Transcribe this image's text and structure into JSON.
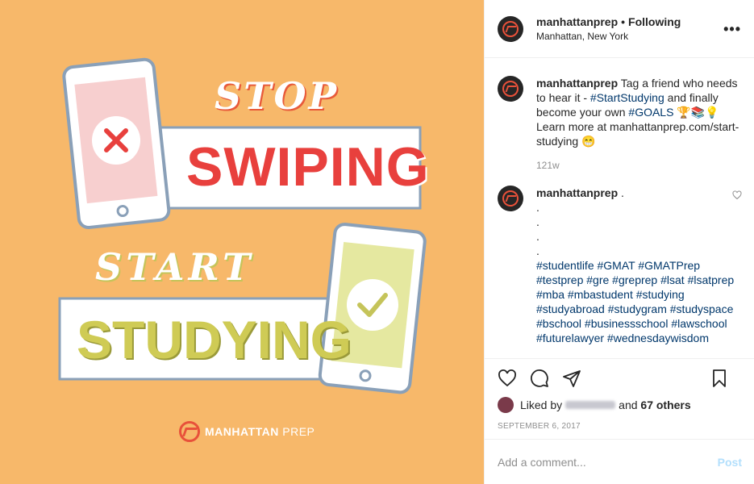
{
  "image": {
    "line1": "STOP",
    "line2": "SWIPING",
    "line3": "START",
    "line4": "STUDYING",
    "brand_bold": "MANHATTAN",
    "brand_light": "PREP",
    "colors": {
      "background": "#f7b86a",
      "red": "#e8403d",
      "green": "#cfcb55"
    }
  },
  "header": {
    "username": "manhattanprep",
    "separator": "•",
    "follow_status": "Following",
    "location": "Manhattan, New York",
    "more_icon": "more-horizontal-icon"
  },
  "caption": {
    "username": "manhattanprep",
    "text_1": "Tag a friend who needs to hear it - ",
    "hashtag_1": "#StartStudying",
    "text_2": " and finally become your own ",
    "hashtag_2": "#GOALS",
    "emojis": "🏆📚💡",
    "text_3": "Learn more at manhattanprep.com/start-studying ",
    "emoji_end": "😁",
    "time": "121w"
  },
  "comment": {
    "username": "manhattanprep",
    "first_dot": ".",
    "dots": [
      ".",
      ".",
      ".",
      "."
    ],
    "hashtags": "#studentlife #GMAT #GMATPrep #testprep #gre #greprep #lsat #lsatprep #mba #mbastudent #studying #studyabroad #studygram #studyspace #bschool #businessschool #lawschool #futurelawyer #wednesdaywisdom"
  },
  "actions": {
    "liked_prefix": "Liked by",
    "liked_and": "and",
    "liked_others": "67 others",
    "date": "SEPTEMBER 6, 2017"
  },
  "add_comment": {
    "placeholder": "Add a comment...",
    "post_label": "Post"
  }
}
